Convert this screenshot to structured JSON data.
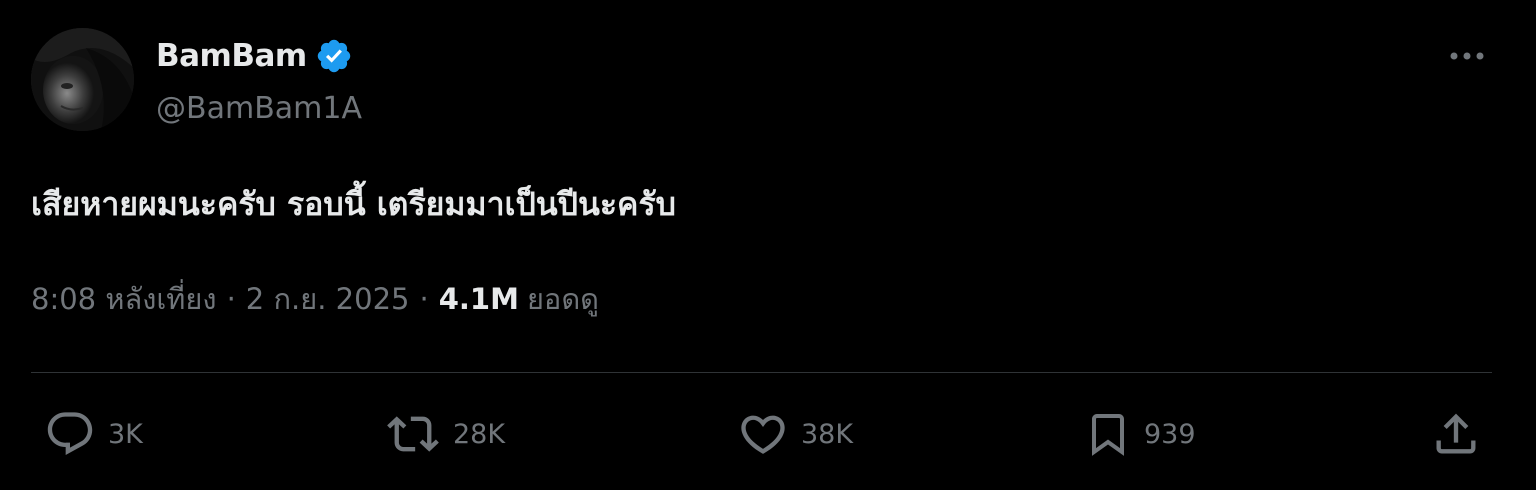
{
  "author": {
    "display_name": "BamBam",
    "handle": "@BamBam1A",
    "verified": true,
    "verified_color": "#1d9bf0"
  },
  "tweet": {
    "text": "เสียหายผมนะครับ รอบนี้ เตรียมมาเป็นปีนะครับ"
  },
  "meta": {
    "time": "8:08 หลังเที่ยง",
    "separator": "·",
    "date": "2 ก.ย. 2025",
    "views_count": "4.1M",
    "views_label": "ยอดดู"
  },
  "actions": {
    "replies": "3K",
    "reposts": "28K",
    "likes": "38K",
    "bookmarks": "939"
  },
  "icons": {
    "more": "more-horizontal-icon",
    "verified": "verified-badge-icon",
    "reply": "reply-icon",
    "repost": "repost-icon",
    "like": "heart-icon",
    "bookmark": "bookmark-icon",
    "share": "share-icon"
  },
  "colors": {
    "background": "#000000",
    "primary_text": "#e7e9ea",
    "secondary_text": "#71767b",
    "divider": "#2f3336"
  }
}
